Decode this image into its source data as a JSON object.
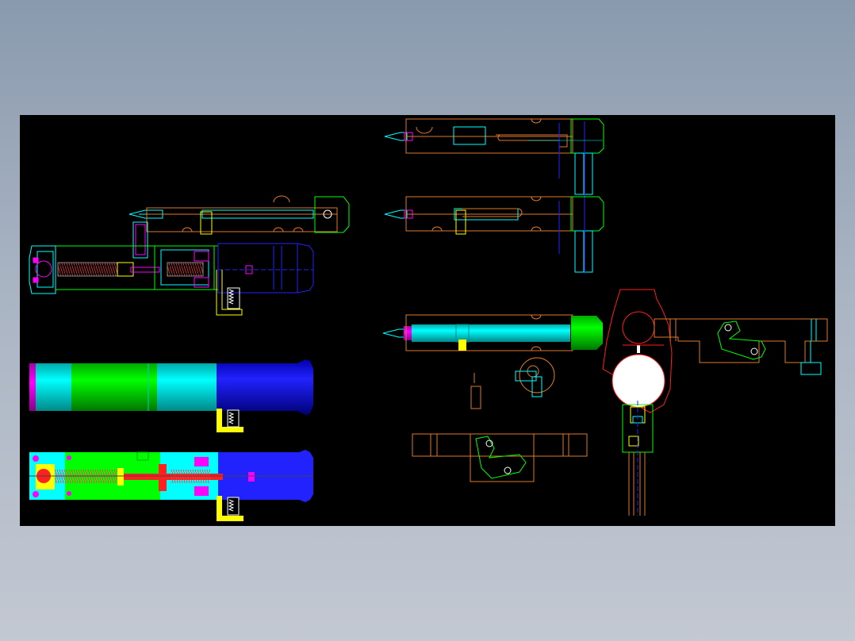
{
  "colors": {
    "background": "#000000",
    "orange": "#e0782a",
    "cyan": "#00ffff",
    "green": "#00ff00",
    "blue": "#1010ff",
    "magenta": "#ff00ff",
    "red": "#ff2020",
    "yellow": "#ffff00",
    "white": "#ffffff"
  },
  "viewport": {
    "name": "cad-drawing-viewport"
  }
}
